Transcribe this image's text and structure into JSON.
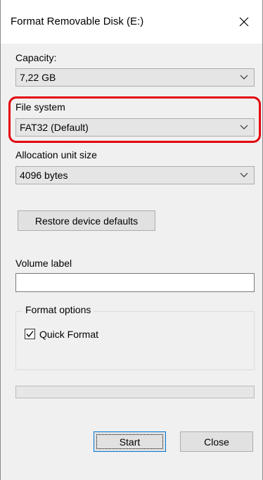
{
  "window": {
    "title": "Format Removable Disk (E:)",
    "close_glyph": "✕"
  },
  "capacity": {
    "label": "Capacity:",
    "value": "7,22 GB"
  },
  "file_system": {
    "label": "File system",
    "value": "FAT32 (Default)"
  },
  "allocation": {
    "label": "Allocation unit size",
    "value": "4096 bytes"
  },
  "restore_button": {
    "label": "Restore device defaults"
  },
  "volume_label": {
    "label": "Volume label",
    "value": ""
  },
  "format_options": {
    "label": "Format options",
    "quick_format": {
      "label": "Quick Format",
      "checked": true
    }
  },
  "progress": {
    "percent": 0
  },
  "buttons": {
    "start": "Start",
    "close": "Close"
  },
  "colors": {
    "highlight": "#e3000f",
    "accent": "#0078d7"
  },
  "icons": [
    "close-icon",
    "chevron-down-icon",
    "checkmark-icon"
  ]
}
